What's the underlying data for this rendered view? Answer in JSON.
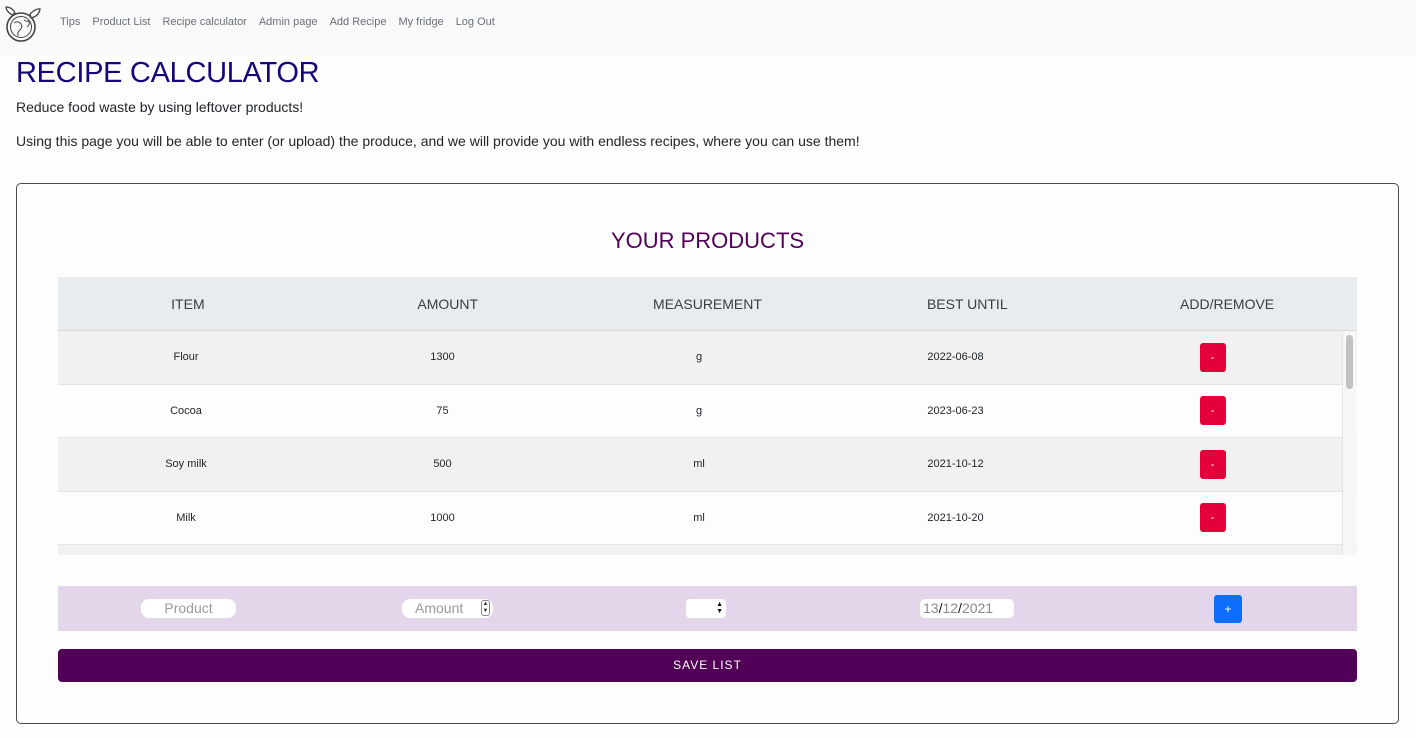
{
  "nav": {
    "items": [
      "Tips",
      "Product List",
      "Recipe calculator",
      "Admin page",
      "Add Recipe",
      "My fridge",
      "Log Out"
    ]
  },
  "header": {
    "title": "RECIPE CALCULATOR",
    "subtitle": "Reduce food waste by using leftover products!",
    "description": "Using this page you will be able to enter (or upload) the produce, and we will provide you with endless recipes, where you can use them!"
  },
  "products": {
    "title": "YOUR PRODUCTS",
    "columns": [
      "ITEM",
      "AMOUNT",
      "MEASUREMENT",
      "BEST UNTIL",
      "ADD/REMOVE"
    ],
    "rows": [
      {
        "item": "Flour",
        "amount": "1300",
        "measurement": "g",
        "best_until": "2022-06-08"
      },
      {
        "item": "Cocoa",
        "amount": "75",
        "measurement": "g",
        "best_until": "2023-06-23"
      },
      {
        "item": "Soy milk",
        "amount": "500",
        "measurement": "ml",
        "best_until": "2021-10-12"
      },
      {
        "item": "Milk",
        "amount": "1000",
        "measurement": "ml",
        "best_until": "2021-10-20"
      }
    ],
    "remove_label": "-"
  },
  "new_product": {
    "product_placeholder": "Product",
    "amount_placeholder": "Amount",
    "date_day": "13",
    "date_month": "12",
    "date_year": "2021",
    "date_sep": "/",
    "add_label": "+"
  },
  "save_label": "SAVE LIST",
  "colors": {
    "title": "#14057a",
    "accent": "#520057",
    "remove": "#e4003a",
    "add": "#0d6efd",
    "input_row": "#e4d6ea"
  }
}
